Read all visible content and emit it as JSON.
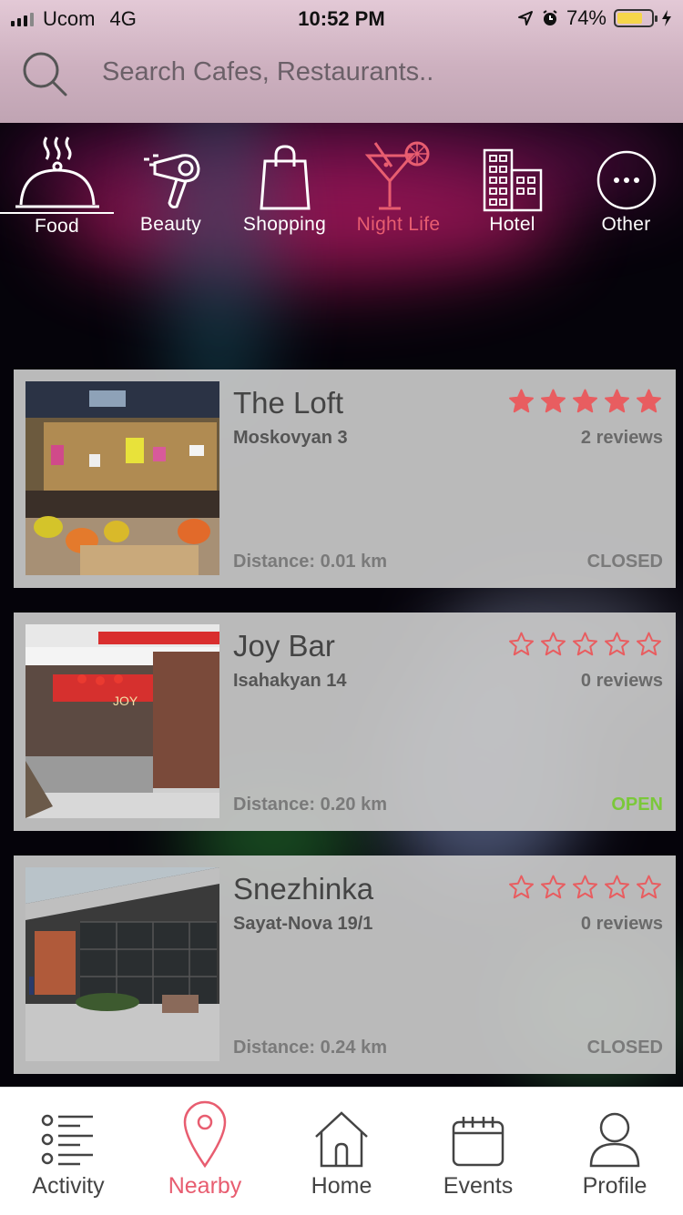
{
  "status": {
    "carrier": "Ucom",
    "network": "4G",
    "time": "10:52 PM",
    "battery": "74%",
    "battery_level": 0.74
  },
  "search": {
    "placeholder": "Search Cafes, Restaurants.."
  },
  "categories": [
    {
      "label": "Food",
      "icon": "cloche-icon"
    },
    {
      "label": "Beauty",
      "icon": "hair-dryer-icon"
    },
    {
      "label": "Shopping",
      "icon": "shopping-bag-icon"
    },
    {
      "label": "Night Life",
      "icon": "cocktail-icon"
    },
    {
      "label": "Hotel",
      "icon": "hotel-building-icon"
    },
    {
      "label": "Other",
      "icon": "more-icon"
    }
  ],
  "places": [
    {
      "name": "The Loft",
      "address": "Moskovyan 3",
      "rating": 5,
      "reviews": "2 reviews",
      "distance": "Distance: 0.01 km",
      "state": "CLOSED"
    },
    {
      "name": "Joy Bar",
      "address": "Isahakyan 14",
      "rating": 0,
      "reviews": "0 reviews",
      "distance": "Distance: 0.20 km",
      "state": "OPEN"
    },
    {
      "name": "Snezhinka",
      "address": "Sayat-Nova 19/1",
      "rating": 0,
      "reviews": "0 reviews",
      "distance": "Distance: 0.24 km",
      "state": "CLOSED"
    }
  ],
  "photo_texts": {
    "joy_sign": "JOY"
  },
  "colors": {
    "accent": "#e85d70",
    "star": "#e85d60",
    "open": "#7bc83a",
    "closed": "#7a7a7a"
  },
  "tabs": [
    {
      "label": "Activity",
      "icon": "list-icon"
    },
    {
      "label": "Nearby",
      "icon": "map-pin-icon"
    },
    {
      "label": "Home",
      "icon": "home-icon"
    },
    {
      "label": "Events",
      "icon": "calendar-icon"
    },
    {
      "label": "Profile",
      "icon": "user-icon"
    }
  ]
}
